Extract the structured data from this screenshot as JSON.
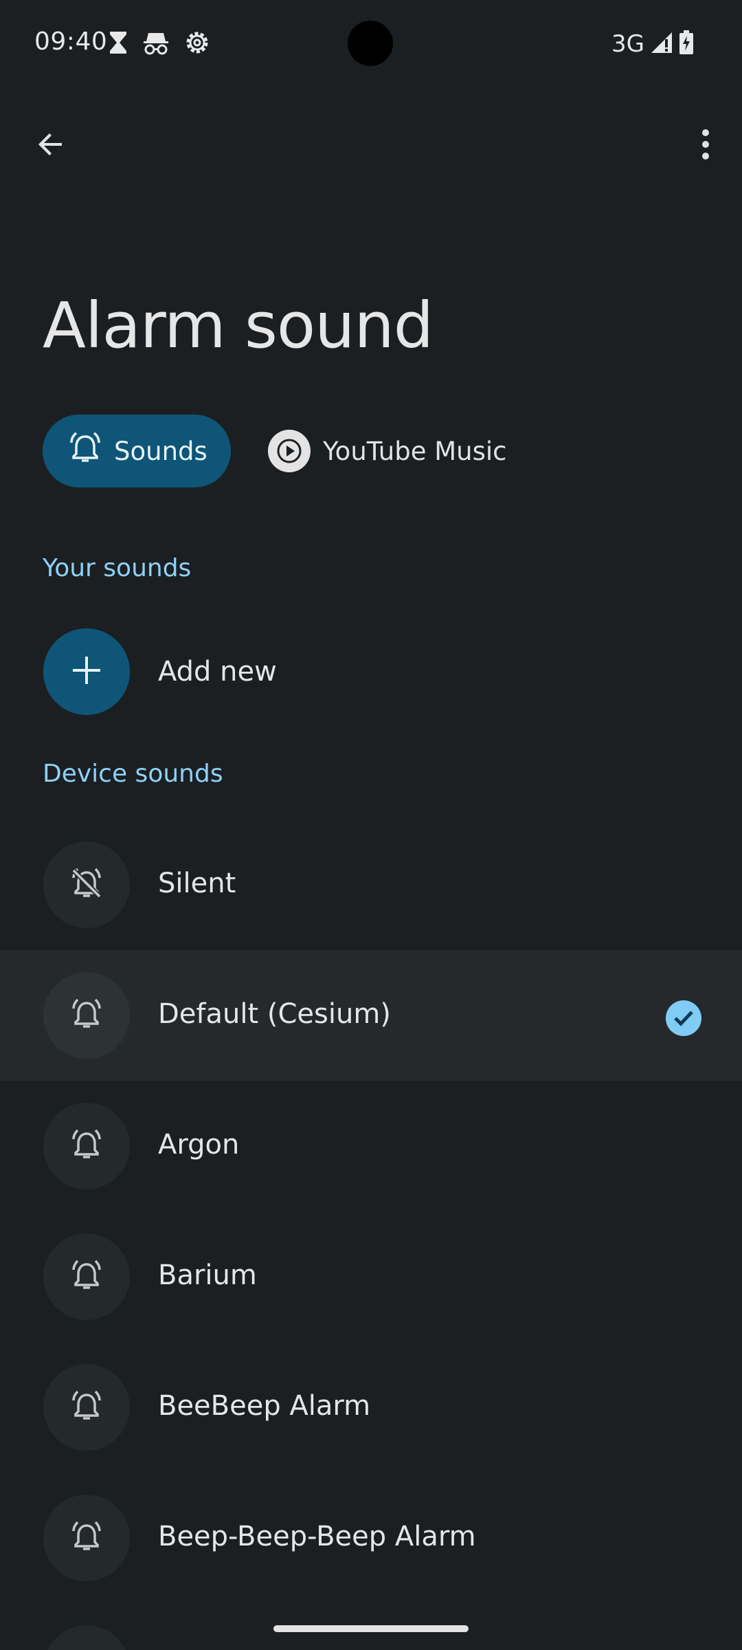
{
  "status_bar": {
    "time": "09:40",
    "left_icons": [
      "hourglass-icon",
      "incognito-icon",
      "settings-icon"
    ],
    "network": "3G",
    "right_icons": [
      "signal-icon",
      "battery-charging-icon"
    ]
  },
  "app_bar": {
    "back_icon": "arrow-back-icon",
    "more_icon": "more-vert-icon"
  },
  "page": {
    "title": "Alarm sound"
  },
  "chips": [
    {
      "label": "Sounds",
      "icon": "alarm-bell-icon",
      "selected": true
    },
    {
      "label": "YouTube Music",
      "icon": "play-circle-icon",
      "selected": false
    }
  ],
  "sections": {
    "your_sounds": "Your sounds",
    "device_sounds": "Device sounds"
  },
  "add_new": {
    "label": "Add new",
    "icon": "add-icon"
  },
  "sounds": [
    {
      "label": "Silent",
      "icon": "alarm-off-icon",
      "selected": false
    },
    {
      "label": "Default (Cesium)",
      "icon": "alarm-bell-icon",
      "selected": true
    },
    {
      "label": "Argon",
      "icon": "alarm-bell-icon",
      "selected": false
    },
    {
      "label": "Barium",
      "icon": "alarm-bell-icon",
      "selected": false
    },
    {
      "label": "BeeBeep Alarm",
      "icon": "alarm-bell-icon",
      "selected": false
    },
    {
      "label": "Beep-Beep-Beep Alarm",
      "icon": "alarm-bell-icon",
      "selected": false
    }
  ],
  "colors": {
    "background": "#1b1f22",
    "accent_chip": "#0f5577",
    "section_header": "#8fd1f6",
    "selected_row": "#25292c",
    "check": "#7fcdf5"
  }
}
